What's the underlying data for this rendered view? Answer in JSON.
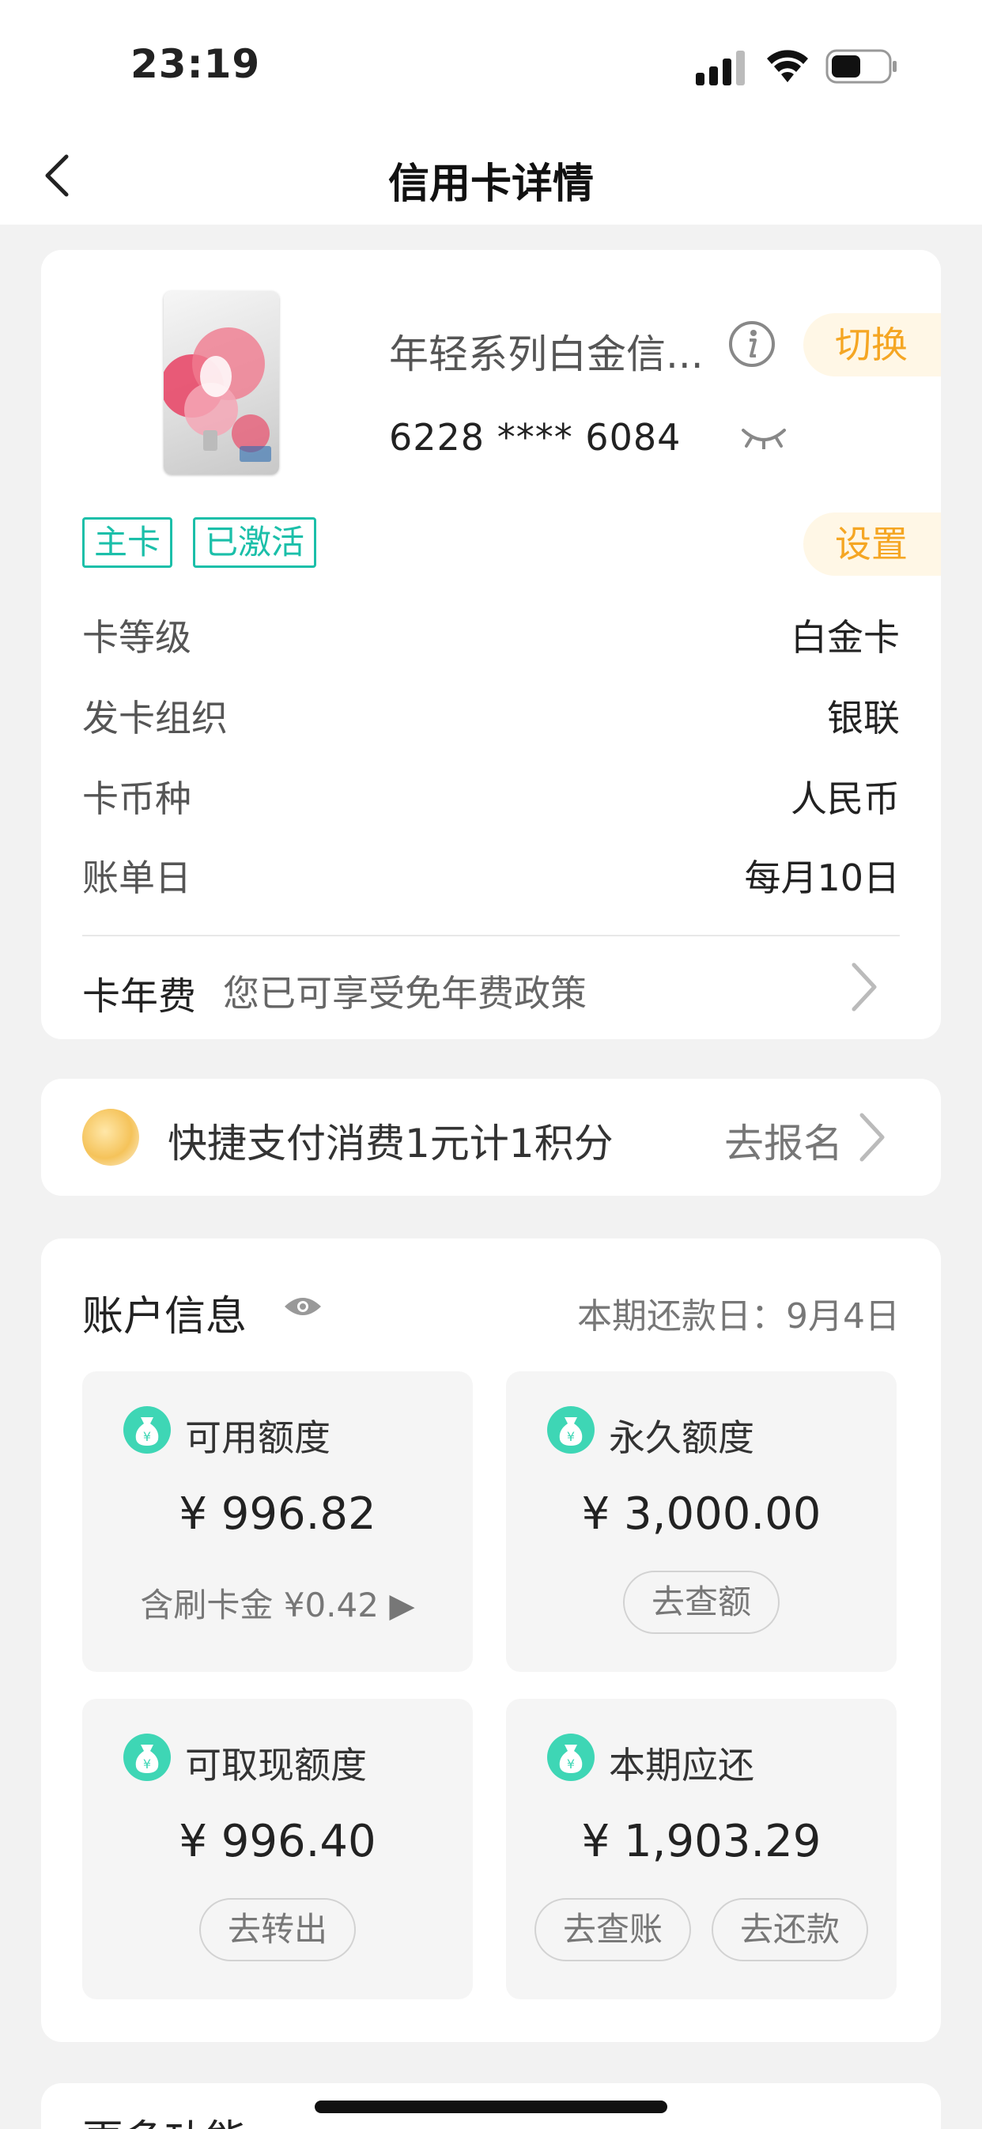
{
  "status_bar": {
    "time": "23:19"
  },
  "nav": {
    "title": "信用卡详情"
  },
  "card": {
    "name": "年轻系列白金信...",
    "number": "6228 **** 6084",
    "switch_label": "切换",
    "settings_label": "设置",
    "tags": [
      "主卡",
      "已激活"
    ],
    "details": [
      {
        "label": "卡等级",
        "value": "白金卡"
      },
      {
        "label": "发卡组织",
        "value": "银联"
      },
      {
        "label": "卡币种",
        "value": "人民币"
      },
      {
        "label": "账单日",
        "value": "每月10日"
      }
    ],
    "annual_fee": {
      "label": "卡年费",
      "text": "您已可享受免年费政策"
    }
  },
  "promo": {
    "text": "快捷支付消费1元计1积分",
    "link": "去报名"
  },
  "account": {
    "title": "账户信息",
    "due_date": "本期还款日：9月4日",
    "tiles": [
      {
        "label": "可用额度",
        "amount": "¥ 996.82",
        "sub": "含刷卡金 ¥0.42 ▶"
      },
      {
        "label": "永久额度",
        "amount": "¥ 3,000.00",
        "button": "去查额"
      },
      {
        "label": "可取现额度",
        "amount": "¥ 996.40",
        "button": "去转出"
      },
      {
        "label": "本期应还",
        "amount": "¥ 1,903.29",
        "button1": "去查账",
        "button2": "去还款"
      }
    ]
  },
  "more": {
    "title": "更多功能"
  },
  "colors": {
    "accent_teal": "#1bbfa9",
    "accent_orange": "#f5a623"
  }
}
